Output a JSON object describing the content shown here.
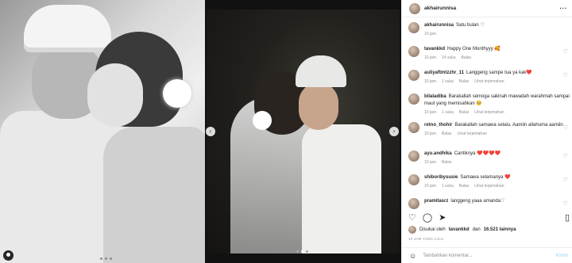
{
  "post": {
    "author": "akhairunnisa",
    "caption": "Satu bulan ♡",
    "caption_time": "10 jam"
  },
  "comments": [
    {
      "user": "tavankkd",
      "text": "Happy One Monthyyy 🥰",
      "time": "10 jam",
      "likes": "14 suka",
      "reply": "Balas",
      "translate": ""
    },
    {
      "user": "auliyaftmtzzhr_11",
      "text": "Langgeng sampe tua ya kak❤️",
      "time": "10 jam",
      "likes": "1 suka",
      "reply": "Balas",
      "translate": "Lihat terjemahan"
    },
    {
      "user": "bilaladiba",
      "text": "Barakallah semoga sakinah mawadah warahmah sampai maut yang memisahkan 🥺",
      "time": "10 jam",
      "likes": "1 suka",
      "reply": "Balas",
      "translate": "Lihat terjemahan"
    },
    {
      "user": "retno_thohir",
      "text": "Barakallah samawa selalu. Aamiin allahuma aamiin",
      "time": "10 jam",
      "likes": "",
      "reply": "Balas",
      "translate": "Lihat terjemahan"
    },
    {
      "user": "ayu.andhika",
      "text": "Cantiknya ❤️❤️❤️❤️",
      "time": "10 jam",
      "likes": "",
      "reply": "Balas",
      "translate": ""
    },
    {
      "user": "shiboribysusie",
      "text": "Samawa selamanya ❤️",
      "time": "10 jam",
      "likes": "1 suka",
      "reply": "Balas",
      "translate": "Lihat terjemahan"
    },
    {
      "user": "pramitasrz",
      "text": "langgeng yaaa amanda♡",
      "time": "",
      "likes": "",
      "reply": "",
      "translate": ""
    }
  ],
  "liked_by": {
    "prefix": "Disukai oleh",
    "user": "tavankkd",
    "middle": "dan",
    "count": "16.521 lainnya"
  },
  "post_time": "10 JAM YANG LALU",
  "add_comment": {
    "placeholder": "Tambahkan komentar...",
    "send_label": "Kirim"
  },
  "icons": {
    "like": "heart-icon",
    "comment": "comment-icon",
    "share": "share-icon",
    "save": "bookmark-icon",
    "more": "more-icon",
    "emoji": "emoji-icon",
    "tag": "user-tag-icon",
    "prev": "chevron-left-icon",
    "next": "chevron-right-icon"
  }
}
